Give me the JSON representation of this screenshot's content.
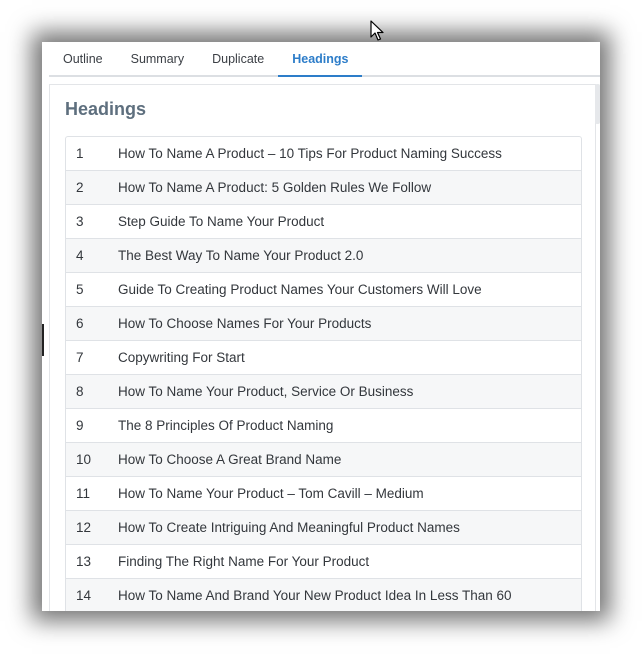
{
  "tabs": [
    {
      "label": "Outline",
      "active": false
    },
    {
      "label": "Summary",
      "active": false
    },
    {
      "label": "Duplicate",
      "active": false
    },
    {
      "label": "Headings",
      "active": true
    }
  ],
  "panel": {
    "title": "Headings"
  },
  "headings": [
    {
      "num": "1",
      "text": "How To Name A Product – 10 Tips For Product Naming Success"
    },
    {
      "num": "2",
      "text": "How To Name A Product: 5 Golden Rules We Follow"
    },
    {
      "num": "3",
      "text": "Step Guide To Name Your Product"
    },
    {
      "num": "4",
      "text": "The Best Way To Name Your Product 2.0"
    },
    {
      "num": "5",
      "text": "Guide To Creating Product Names Your Customers Will Love"
    },
    {
      "num": "6",
      "text": "How To Choose Names For Your Products"
    },
    {
      "num": "7",
      "text": "Copywriting For Start"
    },
    {
      "num": "8",
      "text": "How To Name Your Product, Service Or Business"
    },
    {
      "num": "9",
      "text": "The 8 Principles Of Product Naming"
    },
    {
      "num": "10",
      "text": "How To Choose A Great Brand Name"
    },
    {
      "num": "11",
      "text": "How To Name Your Product – Tom Cavill – Medium"
    },
    {
      "num": "12",
      "text": "How To Create Intriguing And Meaningful Product Names"
    },
    {
      "num": "13",
      "text": "Finding The Right Name For Your Product"
    },
    {
      "num": "14",
      "text": "How To Name And Brand Your New Product Idea In Less Than 60"
    }
  ],
  "colors": {
    "accent": "#2d7dc9",
    "title": "#5e6f7e"
  },
  "icons": {
    "cursor": "mouse-pointer-icon"
  }
}
